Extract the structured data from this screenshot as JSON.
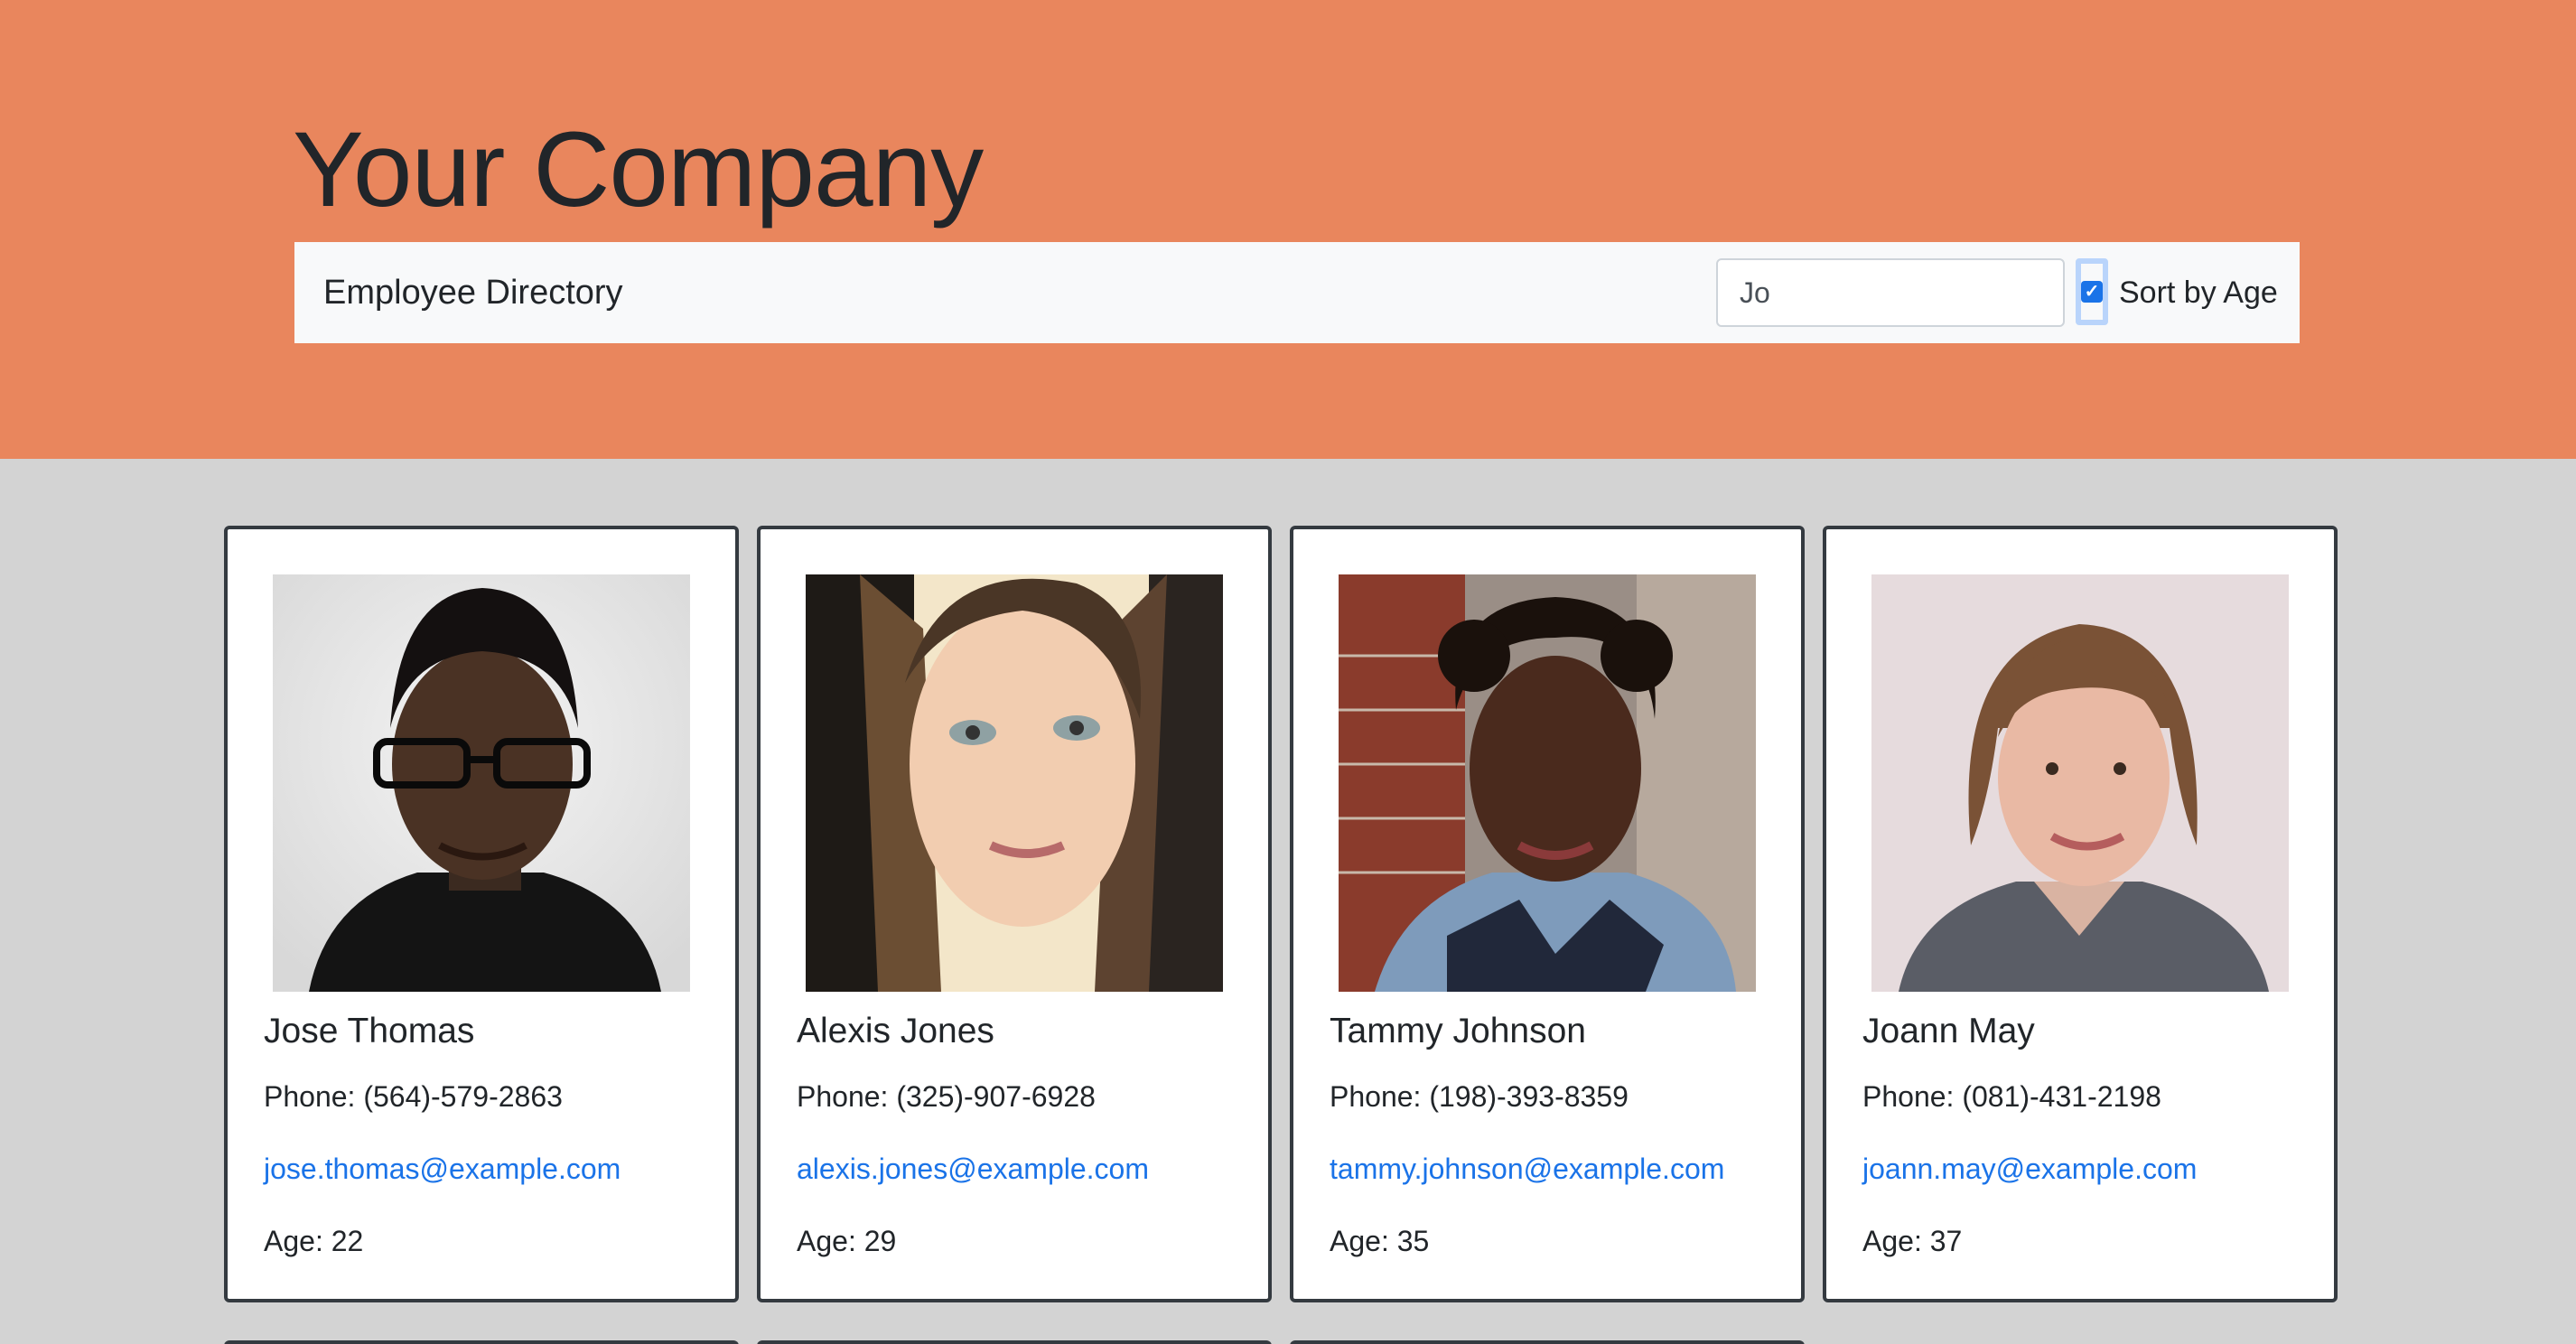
{
  "header": {
    "company_title": "Your Company"
  },
  "navbar": {
    "brand": "Employee Directory",
    "search_value": "Jo",
    "sort_label": "Sort by Age",
    "sort_checked": true
  },
  "employees": [
    {
      "name": "Jose Thomas",
      "phone": "Phone: (564)-579-2863",
      "email": "jose.thomas@example.com",
      "age": "Age: 22"
    },
    {
      "name": "Alexis Jones",
      "phone": "Phone: (325)-907-6928",
      "email": "alexis.jones@example.com",
      "age": "Age: 29"
    },
    {
      "name": "Tammy Johnson",
      "phone": "Phone: (198)-393-8359",
      "email": "tammy.johnson@example.com",
      "age": "Age: 35"
    },
    {
      "name": "Joann May",
      "phone": "Phone: (081)-431-2198",
      "email": "joann.may@example.com",
      "age": "Age: 37"
    }
  ],
  "colors": {
    "header_bg": "#e9865d",
    "page_bg": "#d3d3d3",
    "link": "#1a73e8"
  }
}
